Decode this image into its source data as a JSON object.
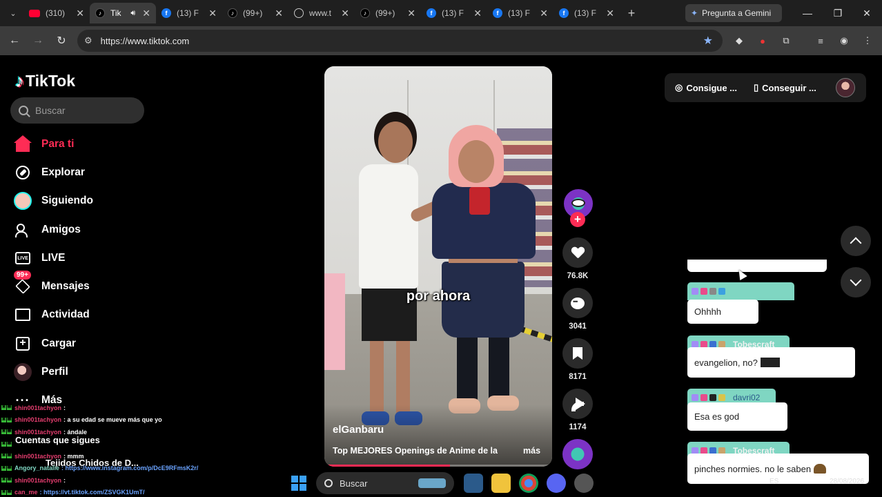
{
  "browser": {
    "tabs": [
      {
        "title": "(310)",
        "favicon": "youtube"
      },
      {
        "title": "Tik",
        "favicon": "tiktok",
        "active": true,
        "audio": true
      },
      {
        "title": "(13) F",
        "favicon": "facebook"
      },
      {
        "title": "(99+)",
        "favicon": "tiktok"
      },
      {
        "title": "www.t",
        "favicon": "globe"
      },
      {
        "title": "(99+)",
        "favicon": "tiktok"
      },
      {
        "title": "(13) F",
        "favicon": "facebook"
      },
      {
        "title": "(13) F",
        "favicon": "facebook"
      },
      {
        "title": "(13) F",
        "favicon": "facebook"
      }
    ],
    "gemini_label": "Pregunta a Gemini",
    "url": "https://www.tiktok.com"
  },
  "tiktok": {
    "brand": "TikTok",
    "search_placeholder": "Buscar",
    "nav": [
      {
        "label": "Para ti",
        "icon": "home-icon",
        "active": true
      },
      {
        "label": "Explorar",
        "icon": "compass-icon"
      },
      {
        "label": "Siguiendo",
        "icon": "following-avatar-icon"
      },
      {
        "label": "Amigos",
        "icon": "friends-icon"
      },
      {
        "label": "LIVE",
        "icon": "live-tv-icon"
      },
      {
        "label": "Mensajes",
        "icon": "messages-icon",
        "badge": "99+"
      },
      {
        "label": "Actividad",
        "icon": "activity-icon"
      },
      {
        "label": "Cargar",
        "icon": "upload-icon"
      },
      {
        "label": "Perfil",
        "icon": "profile-avatar-icon"
      },
      {
        "label": "Más",
        "icon": "more-icon"
      }
    ],
    "following_heading": "Cuentas que sigues",
    "following_first": "Tejidos Chidos de D..."
  },
  "video": {
    "caption": "por ahora",
    "author": "elGanbaru",
    "description": "Top MEJORES Openings de Anime de la",
    "more": "más",
    "likes": "76.8K",
    "comments": "3041",
    "saves": "8171",
    "shares": "1174",
    "progress": 0.55
  },
  "topbar": {
    "coins": "Consigue ...",
    "app": "Conseguir ..."
  },
  "chat_overlay": [
    {
      "user": "shin001tachyon",
      "text": ":"
    },
    {
      "user": "shin001tachyon",
      "text": ": a su edad se mueve más que yo"
    },
    {
      "user": "shin001tachyon",
      "text": ": ándale"
    },
    {
      "user": "",
      "text": ""
    },
    {
      "user": "shin001tachyon",
      "text": ": mmm"
    },
    {
      "user": "Angory_natalie",
      "text": ": https://www.instagram.com/p/DcE9RFmsK2r/"
    },
    {
      "user": "shin001tachyon",
      "text": ":"
    },
    {
      "user": "can_me",
      "text": ": https://vt.tiktok.com/ZSVGK1UmT/"
    }
  ],
  "chat_bubbles": [
    {
      "name": "",
      "text": "Ohhhh"
    },
    {
      "name": "Tobescraft",
      "text": "evangelion, no?"
    },
    {
      "name": "davri02",
      "text": "Esa es god"
    },
    {
      "name": "Tobescraft",
      "text": "pinches normies. no le saben"
    }
  ],
  "taskbar": {
    "search_label": "Buscar",
    "lang": "ES",
    "date": "28/08/2026"
  }
}
